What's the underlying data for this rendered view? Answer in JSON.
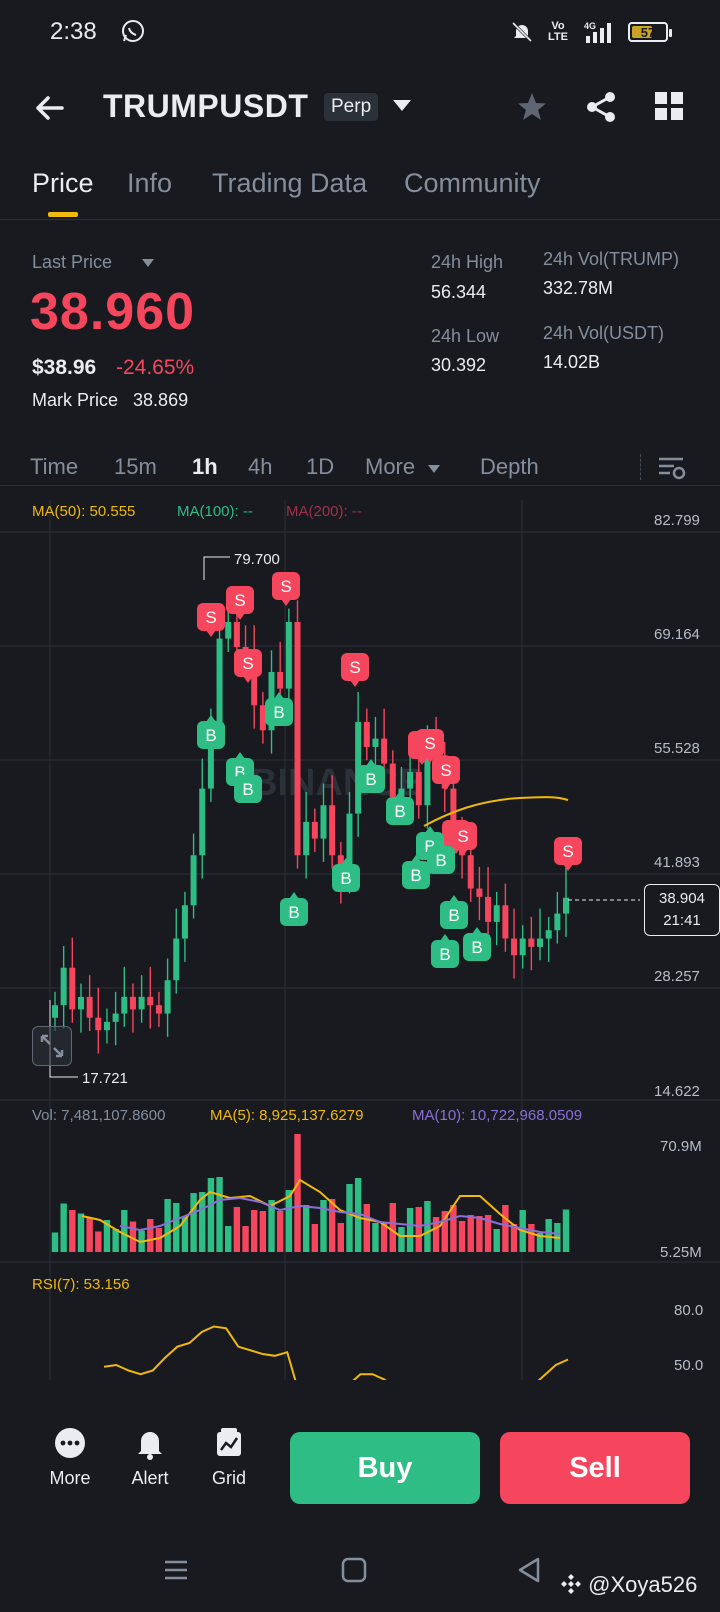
{
  "status_bar": {
    "time": "2:38",
    "volte": "Vo LTE",
    "network": "4G",
    "battery": "57"
  },
  "header": {
    "title": "TRUMPUSDT",
    "contract_type": "Perp"
  },
  "tabs": [
    {
      "label": "Price",
      "active": true
    },
    {
      "label": "Info"
    },
    {
      "label": "Trading Data"
    },
    {
      "label": "Community"
    }
  ],
  "price_info": {
    "last_price_label": "Last Price",
    "last_price": "38.960",
    "usd_price": "$38.96",
    "change_pct": "-24.65%",
    "mark_price_label": "Mark Price",
    "mark_price": "38.869",
    "high_label": "24h High",
    "high": "56.344",
    "low_label": "24h Low",
    "low": "30.392",
    "vol_trump_label": "24h Vol(TRUMP)",
    "vol_trump": "332.78M",
    "vol_usdt_label": "24h Vol(USDT)",
    "vol_usdt": "14.02B"
  },
  "intervals": [
    "Time",
    "15m",
    "1h",
    "4h",
    "1D",
    "More",
    "Depth"
  ],
  "active_interval": "1h",
  "chart": {
    "ma50": "MA(50): 50.555",
    "ma100": "MA(100): --",
    "ma200": "MA(200): --",
    "price_axis": [
      "82.799",
      "69.164",
      "55.528",
      "41.893",
      "28.257",
      "14.622"
    ],
    "high_marker": "79.700",
    "low_marker": "17.721",
    "current_price": "38.904",
    "countdown": "21:41",
    "watermark": "BINANCE",
    "vol_label": "Vol: 7,481,107.8600",
    "vol_ma5": "MA(5): 8,925,137.6279",
    "vol_ma10": "MA(10): 10,722,968.0509",
    "vol_axis": [
      "70.9M",
      "5.25M"
    ],
    "rsi_label": "RSI(7): 53.156",
    "rsi_axis": [
      "80.0",
      "50.0"
    ],
    "buy_marker": "B",
    "sell_marker": "S"
  },
  "chart_data": {
    "type": "candlestick",
    "ylim": [
      14.622,
      82.799
    ],
    "closes": [
      26.0,
      30.5,
      25.5,
      27.0,
      24.5,
      23.0,
      24.0,
      25.0,
      27.0,
      25.5,
      27.0,
      26.0,
      25.0,
      29.0,
      34.0,
      38.0,
      44.0,
      52.0,
      60.0,
      70.0,
      72.0,
      69.0,
      68.0,
      62.0,
      59.0,
      66.0,
      64.0,
      72.0,
      44.0,
      48.0,
      46.0,
      50.0,
      44.0,
      41.0,
      49.0,
      60.0,
      57.0,
      58.0,
      55.0,
      51.0,
      52.0,
      54.0,
      50.0,
      57.0,
      56.0,
      52.0,
      45.0,
      44.0,
      40.0,
      39.0,
      36.0,
      38.0,
      34.0,
      32.0,
      34.0,
      33.0,
      34.0,
      35.0,
      37.0,
      38.9
    ],
    "rsi": [
      49,
      50,
      47,
      45,
      47,
      54,
      60,
      62,
      68,
      71,
      70,
      60,
      58,
      56,
      55,
      57,
      34,
      33,
      32,
      31,
      39,
      45,
      45,
      42,
      35,
      32,
      38,
      38,
      30,
      28,
      28,
      32,
      35,
      30,
      32,
      38,
      44,
      50,
      53
    ],
    "volume_range": [
      "5.25M",
      "70.9M"
    ]
  },
  "bottom_bar": {
    "more": "More",
    "alert": "Alert",
    "grid": "Grid",
    "buy": "Buy",
    "sell": "Sell"
  },
  "footer": {
    "watermark": "@Xoya526"
  },
  "colors": {
    "up": "#2ebd85",
    "down": "#f6465d",
    "accent": "#f0b90b",
    "bg": "#181a20"
  }
}
